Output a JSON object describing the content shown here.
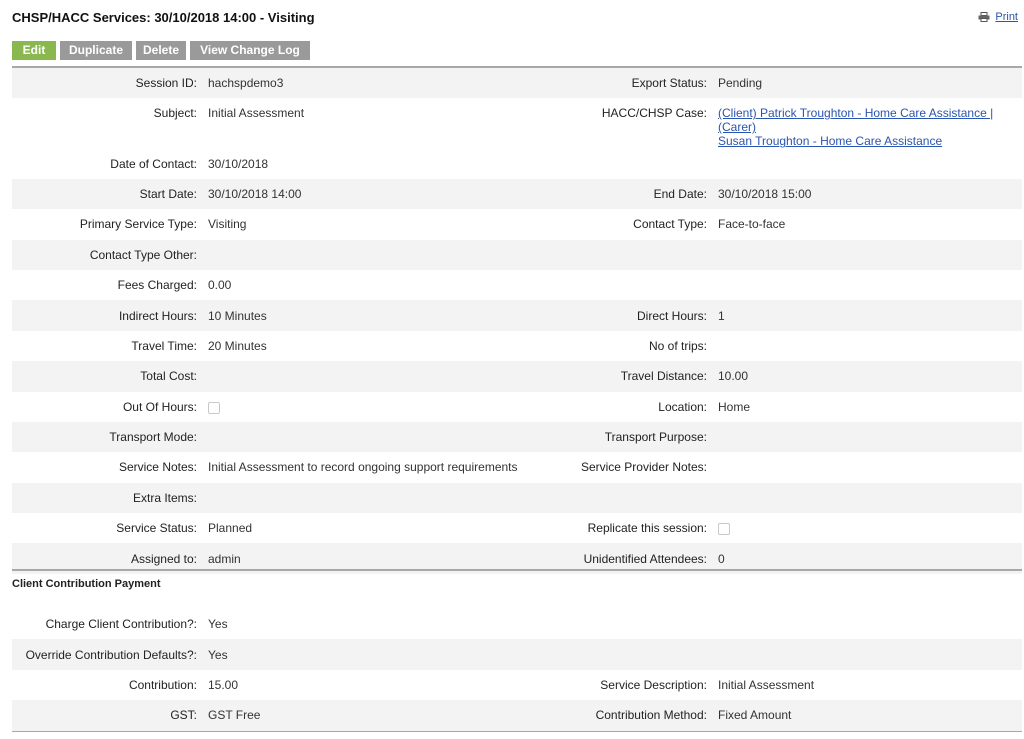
{
  "page": {
    "title": "CHSP/HACC Services: 30/10/2018 14:00 - Visiting",
    "print_label": "Print"
  },
  "toolbar": {
    "edit": "Edit",
    "duplicate": "Duplicate",
    "delete": "Delete",
    "view_change_log": "View Change Log"
  },
  "details": {
    "session_id_label": "Session ID:",
    "session_id": "hachspdemo3",
    "export_status_label": "Export Status:",
    "export_status": "Pending",
    "subject_label": "Subject:",
    "subject": "Initial Assessment",
    "case_label": "HACC/CHSP Case:",
    "case_line1": "(Client) Patrick Troughton - Home Care Assistance | (Carer)",
    "case_line2": "Susan Troughton - Home Care Assistance",
    "date_of_contact_label": "Date of Contact:",
    "date_of_contact": "30/10/2018",
    "start_date_label": "Start Date:",
    "start_date": "30/10/2018 14:00",
    "end_date_label": "End Date:",
    "end_date": "30/10/2018 15:00",
    "primary_service_type_label": "Primary Service Type:",
    "primary_service_type": "Visiting",
    "contact_type_label": "Contact Type:",
    "contact_type": "Face-to-face",
    "contact_type_other_label": "Contact Type Other:",
    "fees_charged_label": "Fees Charged:",
    "fees_charged": "0.00",
    "indirect_hours_label": "Indirect Hours:",
    "indirect_hours": "10 Minutes",
    "direct_hours_label": "Direct Hours:",
    "direct_hours": "1",
    "travel_time_label": "Travel Time:",
    "travel_time": "20 Minutes",
    "no_of_trips_label": "No of trips:",
    "total_cost_label": "Total Cost:",
    "travel_distance_label": "Travel Distance:",
    "travel_distance": "10.00",
    "out_of_hours_label": "Out Of Hours:",
    "out_of_hours_checked": false,
    "location_label": "Location:",
    "location": "Home",
    "transport_mode_label": "Transport Mode:",
    "transport_purpose_label": "Transport Purpose:",
    "service_notes_label": "Service Notes:",
    "service_notes": "Initial Assessment to record ongoing support requirements",
    "service_provider_notes_label": "Service Provider Notes:",
    "extra_items_label": "Extra Items:",
    "service_status_label": "Service Status:",
    "service_status": "Planned",
    "replicate_label": "Replicate this session:",
    "replicate_checked": false,
    "assigned_to_label": "Assigned to:",
    "assigned_to": "admin",
    "unidentified_attendees_label": "Unidentified Attendees:",
    "unidentified_attendees": "0"
  },
  "payment": {
    "section_title": "Client Contribution Payment",
    "charge_label": "Charge Client Contribution?:",
    "charge": "Yes",
    "override_label": "Override Contribution Defaults?:",
    "override": "Yes",
    "contribution_label": "Contribution:",
    "contribution": "15.00",
    "service_description_label": "Service Description:",
    "service_description": "Initial Assessment",
    "gst_label": "GST:",
    "gst": "GST Free",
    "method_label": "Contribution Method:",
    "method": "Fixed Amount"
  },
  "colors": {
    "edit_button": "#8ab84f",
    "gray_button": "#9a9a9a",
    "link": "#2a55b0",
    "row_shade": "#f3f3f3"
  },
  "icons": {
    "print": "printer-icon"
  }
}
